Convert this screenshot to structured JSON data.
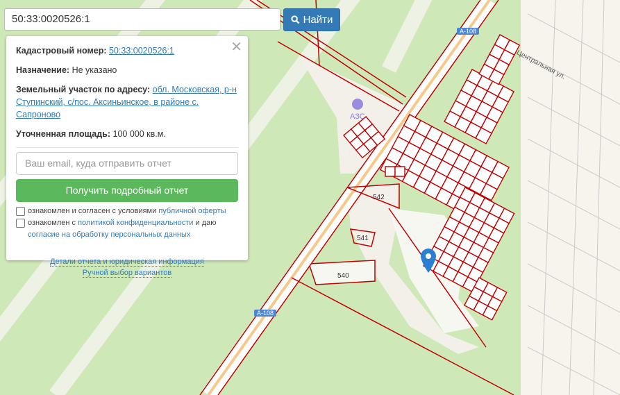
{
  "search": {
    "value": "50:33:0020526:1",
    "button_label": "Найти"
  },
  "panel": {
    "cadastral_label": "Кадастровый номер:",
    "cadastral_value": "50:33:0020526:1",
    "purpose_label": "Назначение:",
    "purpose_value": "Не указано",
    "address_label": "Земельный участок по адресу:",
    "address_value": "обл. Московская, р-н Ступинский, с/пос. Аксиньинское, в районе с. Сапроново",
    "area_label": "Уточненная площадь:",
    "area_value": "100 000 кв.м.",
    "email_placeholder": "Ваш email, куда отправить отчет",
    "get_report_label": "Получить подробный отчет",
    "consent1_text": "ознакомлен и согласен с условиями",
    "consent1_link": "публичной оферты",
    "consent2_text": "ознакомлен с",
    "consent2_link": "политикой конфиденциальности",
    "consent2_mid": "и даю",
    "consent2_link2": "согласие на обработку персональных данных",
    "details_link": "Детали отчета и юридическая информация",
    "manual_link": "Ручной выбор вариантов"
  },
  "map": {
    "road_label_1": "А-108",
    "road_label_2": "А-108",
    "gas_station": "АЗС",
    "street": "Центральная ул.",
    "parcel_542": "542",
    "parcel_541": "541",
    "parcel_540": "540"
  },
  "colors": {
    "accent": "#337ab7",
    "success": "#5cb85c",
    "parcel": "#c00000"
  }
}
